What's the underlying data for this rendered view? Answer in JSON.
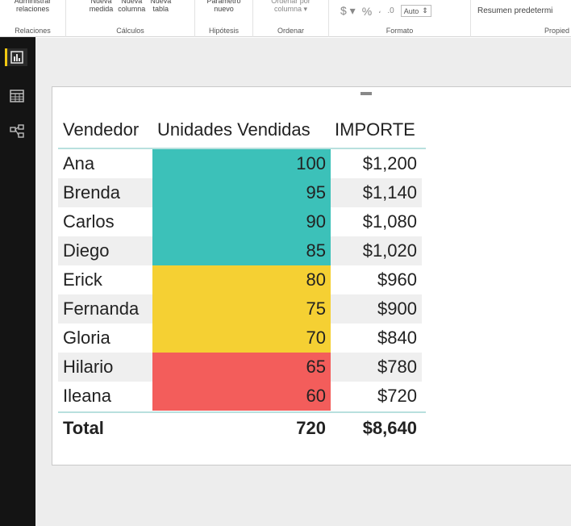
{
  "ribbon": {
    "relaciones": {
      "button": "Administrar\nrelaciones",
      "label": "Relaciones"
    },
    "calculos": {
      "buttons": [
        "Nueva\nmedida",
        "Nueva\ncolumna",
        "Nueva\ntabla"
      ],
      "label": "Cálculos"
    },
    "hipotesis": {
      "button": "Parámetro\nnuevo",
      "label": "Hipótesis"
    },
    "ordenar": {
      "button": "Ordenar por\ncolumna ▾",
      "label": "Ordenar"
    },
    "formato": {
      "currency": "$ ▾",
      "percent": "%",
      "comma": "،",
      "decimals": ".0",
      "auto": "Auto",
      "label": "Formato"
    },
    "propiedades": {
      "summary": "Resumen predetermi",
      "label": "Propied"
    }
  },
  "nav": {
    "items": [
      "report-view",
      "data-view",
      "relationships-view"
    ],
    "active": "report-view"
  },
  "table": {
    "headers": [
      "Vendedor",
      "Unidades Vendidas",
      "IMPORTE"
    ],
    "rows": [
      {
        "vendedor": "Ana",
        "unidades": "100",
        "importe": "$1,200",
        "color": "#3cc1b9"
      },
      {
        "vendedor": "Brenda",
        "unidades": "95",
        "importe": "$1,140",
        "color": "#3cc1b9"
      },
      {
        "vendedor": "Carlos",
        "unidades": "90",
        "importe": "$1,080",
        "color": "#3cc1b9"
      },
      {
        "vendedor": "Diego",
        "unidades": "85",
        "importe": "$1,020",
        "color": "#3cc1b9"
      },
      {
        "vendedor": "Erick",
        "unidades": "80",
        "importe": "$960",
        "color": "#f5d033"
      },
      {
        "vendedor": "Fernanda",
        "unidades": "75",
        "importe": "$900",
        "color": "#f5d033"
      },
      {
        "vendedor": "Gloria",
        "unidades": "70",
        "importe": "$840",
        "color": "#f5d033"
      },
      {
        "vendedor": "Hilario",
        "unidades": "65",
        "importe": "$780",
        "color": "#f35d5b"
      },
      {
        "vendedor": "Ileana",
        "unidades": "60",
        "importe": "$720",
        "color": "#f35d5b"
      }
    ],
    "total": {
      "label": "Total",
      "unidades": "720",
      "importe": "$8,640"
    }
  }
}
